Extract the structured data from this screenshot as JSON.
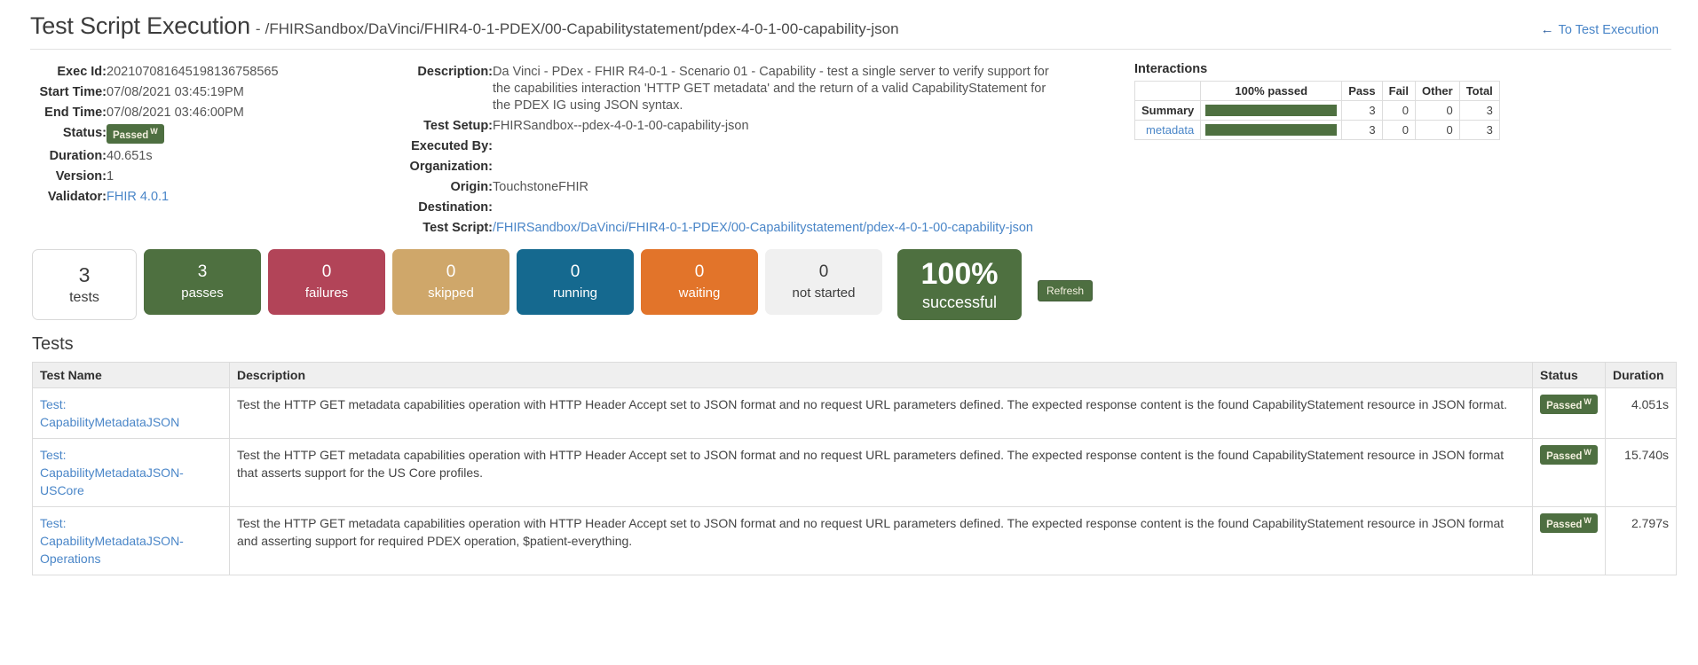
{
  "header": {
    "title": "Test Script Execution",
    "separator": "-",
    "path": "/FHIRSandbox/DaVinci/FHIR4-0-1-PDEX/00-Capabilitystatement/pdex-4-0-1-00-capability-json",
    "back_arrow": "←",
    "back_label": "To Test Execution"
  },
  "meta_left": {
    "exec_id_label": "Exec Id:",
    "exec_id_value": "202107081645198136758565",
    "start_time_label": "Start Time:",
    "start_time_value": "07/08/2021 03:45:19PM",
    "end_time_label": "End Time:",
    "end_time_value": "07/08/2021 03:46:00PM",
    "status_label": "Status:",
    "status_value": "Passed",
    "status_sup": "W",
    "duration_label": "Duration:",
    "duration_value": "40.651s",
    "version_label": "Version:",
    "version_value": "1",
    "validator_label": "Validator:",
    "validator_value": "FHIR 4.0.1"
  },
  "meta_mid": {
    "description_label": "Description:",
    "description_value": "Da Vinci - PDex - FHIR R4-0-1 - Scenario 01 - Capability - test a single server to verify support for the capabilities interaction 'HTTP GET metadata' and the return of a valid CapabilityStatement for the PDEX IG using JSON syntax.",
    "test_setup_label": "Test Setup:",
    "test_setup_value": "FHIRSandbox--pdex-4-0-1-00-capability-json",
    "executed_by_label": "Executed By:",
    "executed_by_value": "",
    "organization_label": "Organization:",
    "organization_value": "",
    "origin_label": "Origin:",
    "origin_value": "TouchstoneFHIR",
    "destination_label": "Destination:",
    "destination_value": "",
    "test_script_label": "Test Script:",
    "test_script_value": "/FHIRSandbox/DaVinci/FHIR4-0-1-PDEX/00-Capabilitystatement/pdex-4-0-1-00-capability-json"
  },
  "interactions": {
    "title": "Interactions",
    "columns": [
      "",
      "100% passed",
      "Pass",
      "Fail",
      "Other",
      "Total"
    ],
    "rows": [
      {
        "label": "Summary",
        "is_link": false,
        "percent": 100,
        "pass": "3",
        "fail": "0",
        "other": "0",
        "total": "3"
      },
      {
        "label": "metadata",
        "is_link": true,
        "percent": 100,
        "pass": "3",
        "fail": "0",
        "other": "0",
        "total": "3"
      }
    ],
    "bar_color": "#4e7040"
  },
  "cards": [
    {
      "num": "3",
      "label": "tests",
      "kind": "tests",
      "color": "#ffffff"
    },
    {
      "num": "3",
      "label": "passes",
      "kind": "passes",
      "color": "#4e7040"
    },
    {
      "num": "0",
      "label": "failures",
      "kind": "failures",
      "color": "#b24458"
    },
    {
      "num": "0",
      "label": "skipped",
      "kind": "skipped",
      "color": "#cfa76a"
    },
    {
      "num": "0",
      "label": "running",
      "kind": "running",
      "color": "#15698f"
    },
    {
      "num": "0",
      "label": "waiting",
      "kind": "waiting",
      "color": "#e2742a"
    },
    {
      "num": "0",
      "label": "not started",
      "kind": "notstarted",
      "color": "#f0f0f0"
    }
  ],
  "percent_card": {
    "num": "100%",
    "label": "successful",
    "color": "#4e7040"
  },
  "refresh_button": "Refresh",
  "tests_section": {
    "heading": "Tests",
    "columns": {
      "name": "Test Name",
      "description": "Description",
      "status": "Status",
      "duration": "Duration"
    },
    "rows": [
      {
        "name_prefix": "Test:",
        "name": "CapabilityMetadataJSON",
        "description": "Test the HTTP GET metadata capabilities operation with HTTP Header Accept set to JSON format and no request URL parameters defined. The expected response content is the found CapabilityStatement resource in JSON format.",
        "status": "Passed",
        "status_sup": "W",
        "duration": "4.051s"
      },
      {
        "name_prefix": "Test:",
        "name": "CapabilityMetadataJSON-USCore",
        "description": "Test the HTTP GET metadata capabilities operation with HTTP Header Accept set to JSON format and no request URL parameters defined. The expected response content is the found CapabilityStatement resource in JSON format that asserts support for the US Core profiles.",
        "status": "Passed",
        "status_sup": "W",
        "duration": "15.740s"
      },
      {
        "name_prefix": "Test:",
        "name": "CapabilityMetadataJSON-Operations",
        "description": "Test the HTTP GET metadata capabilities operation with HTTP Header Accept set to JSON format and no request URL parameters defined. The expected response content is the found CapabilityStatement resource in JSON format and asserting support for required PDEX operation, $patient-everything.",
        "status": "Passed",
        "status_sup": "W",
        "duration": "2.797s"
      }
    ]
  }
}
